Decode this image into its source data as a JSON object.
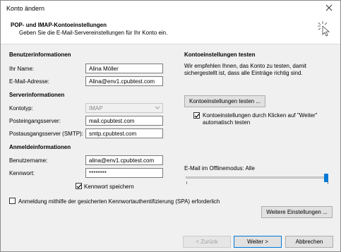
{
  "window": {
    "title": "Konto ändern"
  },
  "header": {
    "title": "POP- und IMAP-Kontoeinstellungen",
    "subtitle": "Geben Sie die E-Mail-Servereinstellungen für Ihr Konto ein."
  },
  "user_info": {
    "section": "Benutzerinformationen",
    "name_label": "Ihr Name:",
    "name_value": "Alina Möller",
    "email_label": "E-Mail-Adresse:",
    "email_value": "Alina@env1.cpubtest.com"
  },
  "server_info": {
    "section": "Serverinformationen",
    "type_label": "Kontotyp:",
    "type_value": "IMAP",
    "incoming_label": "Posteingangsserver:",
    "incoming_value": "mail.cpubtest.com",
    "outgoing_label": "Postausgangsserver (SMTP):",
    "outgoing_value": "smtp.cpubtest.com"
  },
  "login_info": {
    "section": "Anmeldeinformationen",
    "username_label": "Benutzername:",
    "username_value": "alina@env1.cpubtest.com",
    "password_label": "Kennwort:",
    "password_value": "********",
    "save_password_label": "Kennwort speichern",
    "save_password_checked": true
  },
  "spa": {
    "label": "Anmeldung mithilfe der gesicherten Kennwortauthentifizierung (SPA) erforderlich",
    "checked": false
  },
  "test": {
    "section": "Kontoeinstellungen testen",
    "description_line1": "Wir empfehlen Ihnen, das Konto zu testen, damit",
    "description_line2": "sichergestellt ist, dass alle Einträge richtig sind.",
    "test_button": "Kontoeinstellungen testen ...",
    "auto_test_line1": "Kontoeinstellungen durch Klicken auf \"Weiter\"",
    "auto_test_line2": "automatisch testen",
    "auto_test_checked": true
  },
  "offline": {
    "label": "E-Mail im Offlinemodus: Alle",
    "level_fraction": 1.0
  },
  "buttons": {
    "more_settings": "Weitere Einstellungen ...",
    "back": "< Zurück",
    "next": "Weiter >",
    "cancel": "Abbrechen"
  },
  "colors": {
    "accent": "#0078d7"
  },
  "icons": {
    "close": "close-icon",
    "cursor": "cursor-click-icon",
    "check": "checkmark-icon",
    "dropdown": "chevron-down-icon"
  }
}
